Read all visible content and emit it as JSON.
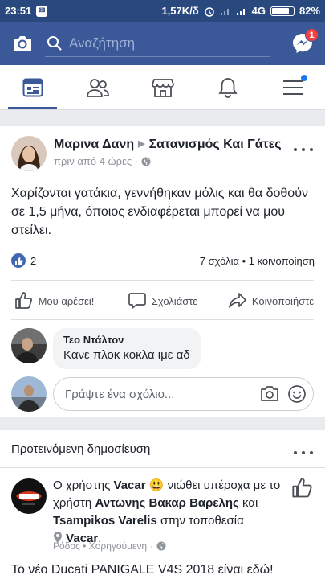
{
  "status_bar": {
    "time": "23:51",
    "speed": "1,57K/δ",
    "network": "4G",
    "battery": "82%",
    "battery_level": 0.82
  },
  "top_bar": {
    "search_placeholder": "Αναζήτηση",
    "messenger_badge": "1"
  },
  "nav_tabs": [
    {
      "icon": "news-feed-icon",
      "active": true
    },
    {
      "icon": "friends-icon",
      "active": false
    },
    {
      "icon": "marketplace-icon",
      "active": false
    },
    {
      "icon": "notifications-icon",
      "active": false
    },
    {
      "icon": "menu-icon",
      "active": false
    }
  ],
  "post": {
    "author": "Μαρινα Δανη",
    "group": "Σατανισμός Και Γάτες",
    "time": "πριν από 4 ώρες",
    "text": "Χαρίζονται γατάκια, γεννήθηκαν μόλις και θα δοθούν σε 1,5 μήνα, όποιος ενδιαφέρεται μπορεί να μου στείλει.",
    "likes": "2",
    "stats": "7 σχόλια • 1 κοινοποίηση",
    "actions": {
      "like": "Μου αρέσει!",
      "comment": "Σχολιάστε",
      "share": "Κοινοποιήστε"
    },
    "comment": {
      "author": "Τεο Ντάλτον",
      "text": "Κανε πλοκ κοκλα ιμε αδ"
    },
    "write_comment_placeholder": "Γράψτε ένα σχόλιο..."
  },
  "suggested": {
    "title": "Προτεινόμενη δημοσίευση",
    "activity": {
      "prefix": "Ο χρήστης ",
      "user": "Vacar",
      "emoji": "😃",
      "feeling": " νιώθει υπέροχα με το χρήστη ",
      "tagged1": "Αντωνης Βακαρ Βαρελης",
      "and": " και ",
      "tagged2": "Tsampikos Varelis",
      "at": " στην τοποθεσία ",
      "place": "Vacar",
      "end": "."
    },
    "meta": "Ρόδος • Χορηγούμενη",
    "text": "Το νέο Ducati PANIGALE V4S 2018 είναι εδώ!"
  },
  "colors": {
    "brand": "#3b5998",
    "status_bar": "#29487d",
    "badge": "#fa3e3e"
  }
}
